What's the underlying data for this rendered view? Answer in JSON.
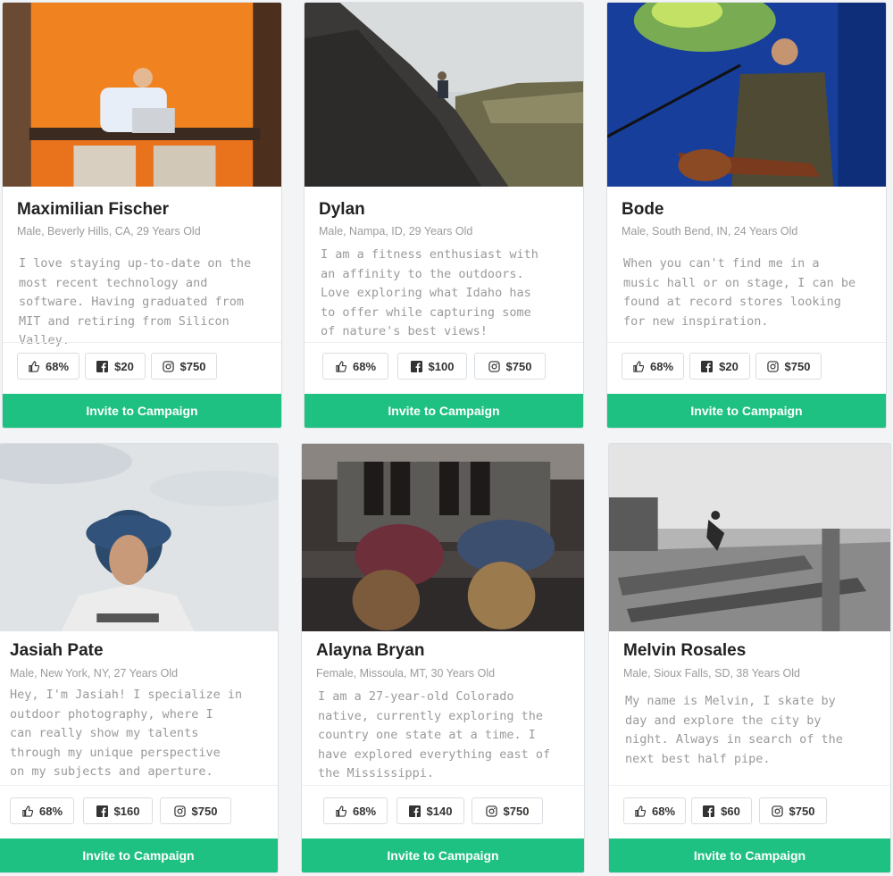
{
  "cards": [
    {
      "name": "Maximilian Fischer",
      "meta": "Male, Beverly Hills, CA, 29 Years Old",
      "bio": [
        "I love staying up-to-date on the",
        "most recent technology and",
        "software. Having graduated from",
        "MIT and retiring from Silicon Valley."
      ],
      "likes": "68%",
      "facebook": "$20",
      "instagram": "$750",
      "invite": "Invite to Campaign"
    },
    {
      "name": "Dylan",
      "meta": "Male, Nampa, ID, 29 Years Old",
      "bio": [
        "I am a fitness enthusiast with",
        "an affinity to the outdoors.",
        "Love exploring what Idaho has",
        "to offer while capturing some",
        "of nature's best views!"
      ],
      "likes": "68%",
      "facebook": "$100",
      "instagram": "$750",
      "invite": "Invite to Campaign"
    },
    {
      "name": "Bode",
      "meta": "Male, South Bend, IN, 24 Years Old",
      "bio": [
        "When you can't find me in a",
        "music hall or on stage, I can be",
        "found at record stores looking",
        "for new inspiration."
      ],
      "likes": "68%",
      "facebook": "$20",
      "instagram": "$750",
      "invite": "Invite to Campaign"
    },
    {
      "name": "Jasiah Pate",
      "meta": "Male, New York, NY, 27 Years Old",
      "bio": [
        "Hey, I'm Jasiah! I specialize in",
        "outdoor photography, where I",
        "can really show my talents",
        "through my unique perspective",
        "on my subjects and aperture."
      ],
      "likes": "68%",
      "facebook": "$160",
      "instagram": "$750",
      "invite": "Invite to Campaign"
    },
    {
      "name": "Alayna Bryan",
      "meta": "Female, Missoula, MT, 30 Years Old",
      "bio": [
        "I am a 27-year-old Colorado",
        "native, currently exploring the",
        "country one state at a time. I",
        "have explored everything east of",
        "the Mississippi."
      ],
      "likes": "68%",
      "facebook": "$140",
      "instagram": "$750",
      "invite": "Invite to Campaign"
    },
    {
      "name": "Melvin Rosales",
      "meta": "Male, Sioux Falls, SD, 38 Years Old",
      "bio": [
        "My name is Melvin, I skate by",
        "day and explore the city by",
        "night. Always in search of the",
        "next best half pipe."
      ],
      "likes": "68%",
      "facebook": "$60",
      "instagram": "$750",
      "invite": "Invite to Campaign"
    }
  ],
  "icons": {
    "likes": "thumbs-up-icon",
    "facebook": "facebook-icon",
    "instagram": "instagram-icon"
  },
  "colors": {
    "accent": "#1fc183",
    "text": "#222222",
    "muted": "#9b9b9b"
  }
}
